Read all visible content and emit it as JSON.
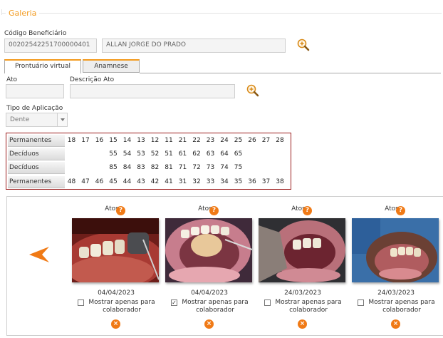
{
  "fieldset": {
    "legend": "Galeria"
  },
  "beneficiario": {
    "label": "Código Beneficiário",
    "code": "00202542251700000401",
    "name": "ALLAN JORGE DO PRADO"
  },
  "tabs": [
    {
      "label": "Prontuário virtual",
      "active": true
    },
    {
      "label": "Anamnese",
      "active": false
    }
  ],
  "ato": {
    "label": "Ato",
    "value": ""
  },
  "descricao_ato": {
    "label": "Descrição Ato",
    "value": ""
  },
  "tipo_aplicacao": {
    "label": "Tipo de Aplicação",
    "selected": "Dente"
  },
  "teeth": [
    {
      "label": "Permanentes",
      "numbers": [
        "18",
        "17",
        "16",
        "15",
        "14",
        "13",
        "12",
        "11",
        "21",
        "22",
        "23",
        "24",
        "25",
        "26",
        "27",
        "28"
      ]
    },
    {
      "label": "Decíduos",
      "numbers": [
        "55",
        "54",
        "53",
        "52",
        "51",
        "61",
        "62",
        "63",
        "64",
        "65"
      ]
    },
    {
      "label": "Decíduos",
      "numbers": [
        "85",
        "84",
        "83",
        "82",
        "81",
        "71",
        "72",
        "73",
        "74",
        "75"
      ]
    },
    {
      "label": "Permanentes",
      "numbers": [
        "48",
        "47",
        "46",
        "45",
        "44",
        "43",
        "42",
        "41",
        "31",
        "32",
        "33",
        "34",
        "35",
        "36",
        "37",
        "38"
      ]
    }
  ],
  "gallery": {
    "items": [
      {
        "atos_label": "Atos",
        "help": "?",
        "date": "04/04/2023",
        "checked": false,
        "checkbox_label": "Mostrar apenas para colaborador",
        "delete": "×"
      },
      {
        "atos_label": "Atos",
        "help": "?",
        "date": "04/04/2023",
        "checked": true,
        "checkbox_label": "Mostrar apenas para colaborador",
        "delete": "×"
      },
      {
        "atos_label": "Atos",
        "help": "?",
        "date": "24/03/2023",
        "checked": false,
        "checkbox_label": "Mostrar apenas para colaborador",
        "delete": "×"
      },
      {
        "atos_label": "Atos",
        "help": "?",
        "date": "24/03/2023",
        "checked": false,
        "checkbox_label": "Mostrar apenas para colaborador",
        "delete": "×"
      }
    ]
  },
  "colors": {
    "accent": "#f39a1d",
    "icon_orange": "#f07a16",
    "tooth_border": "#9b1c1c"
  },
  "icons": {
    "zoom": "magnifier-plus-icon",
    "prev": "arrow-left-icon",
    "help": "question-icon",
    "delete": "close-icon",
    "check": "✓"
  }
}
